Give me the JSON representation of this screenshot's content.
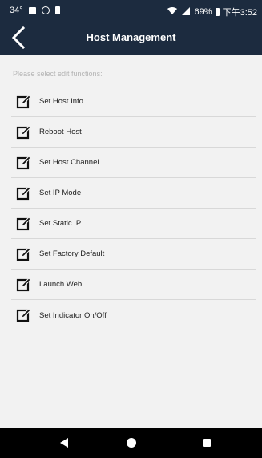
{
  "status_bar": {
    "temperature": "34°",
    "battery_percent": "69%",
    "time": "下午3:52"
  },
  "header": {
    "title": "Host Management"
  },
  "content": {
    "prompt": "Please select edit functions:",
    "items": [
      {
        "label": "Set Host Info"
      },
      {
        "label": "Reboot Host"
      },
      {
        "label": "Set Host Channel"
      },
      {
        "label": "Set IP Mode"
      },
      {
        "label": "Set Static IP"
      },
      {
        "label": "Set Factory Default"
      },
      {
        "label": "Launch Web"
      },
      {
        "label": "Set Indicator On/Off"
      }
    ]
  },
  "colors": {
    "header_bg": "#1c2b3f",
    "content_bg": "#f2f2f2",
    "nav_bg": "#000000"
  }
}
